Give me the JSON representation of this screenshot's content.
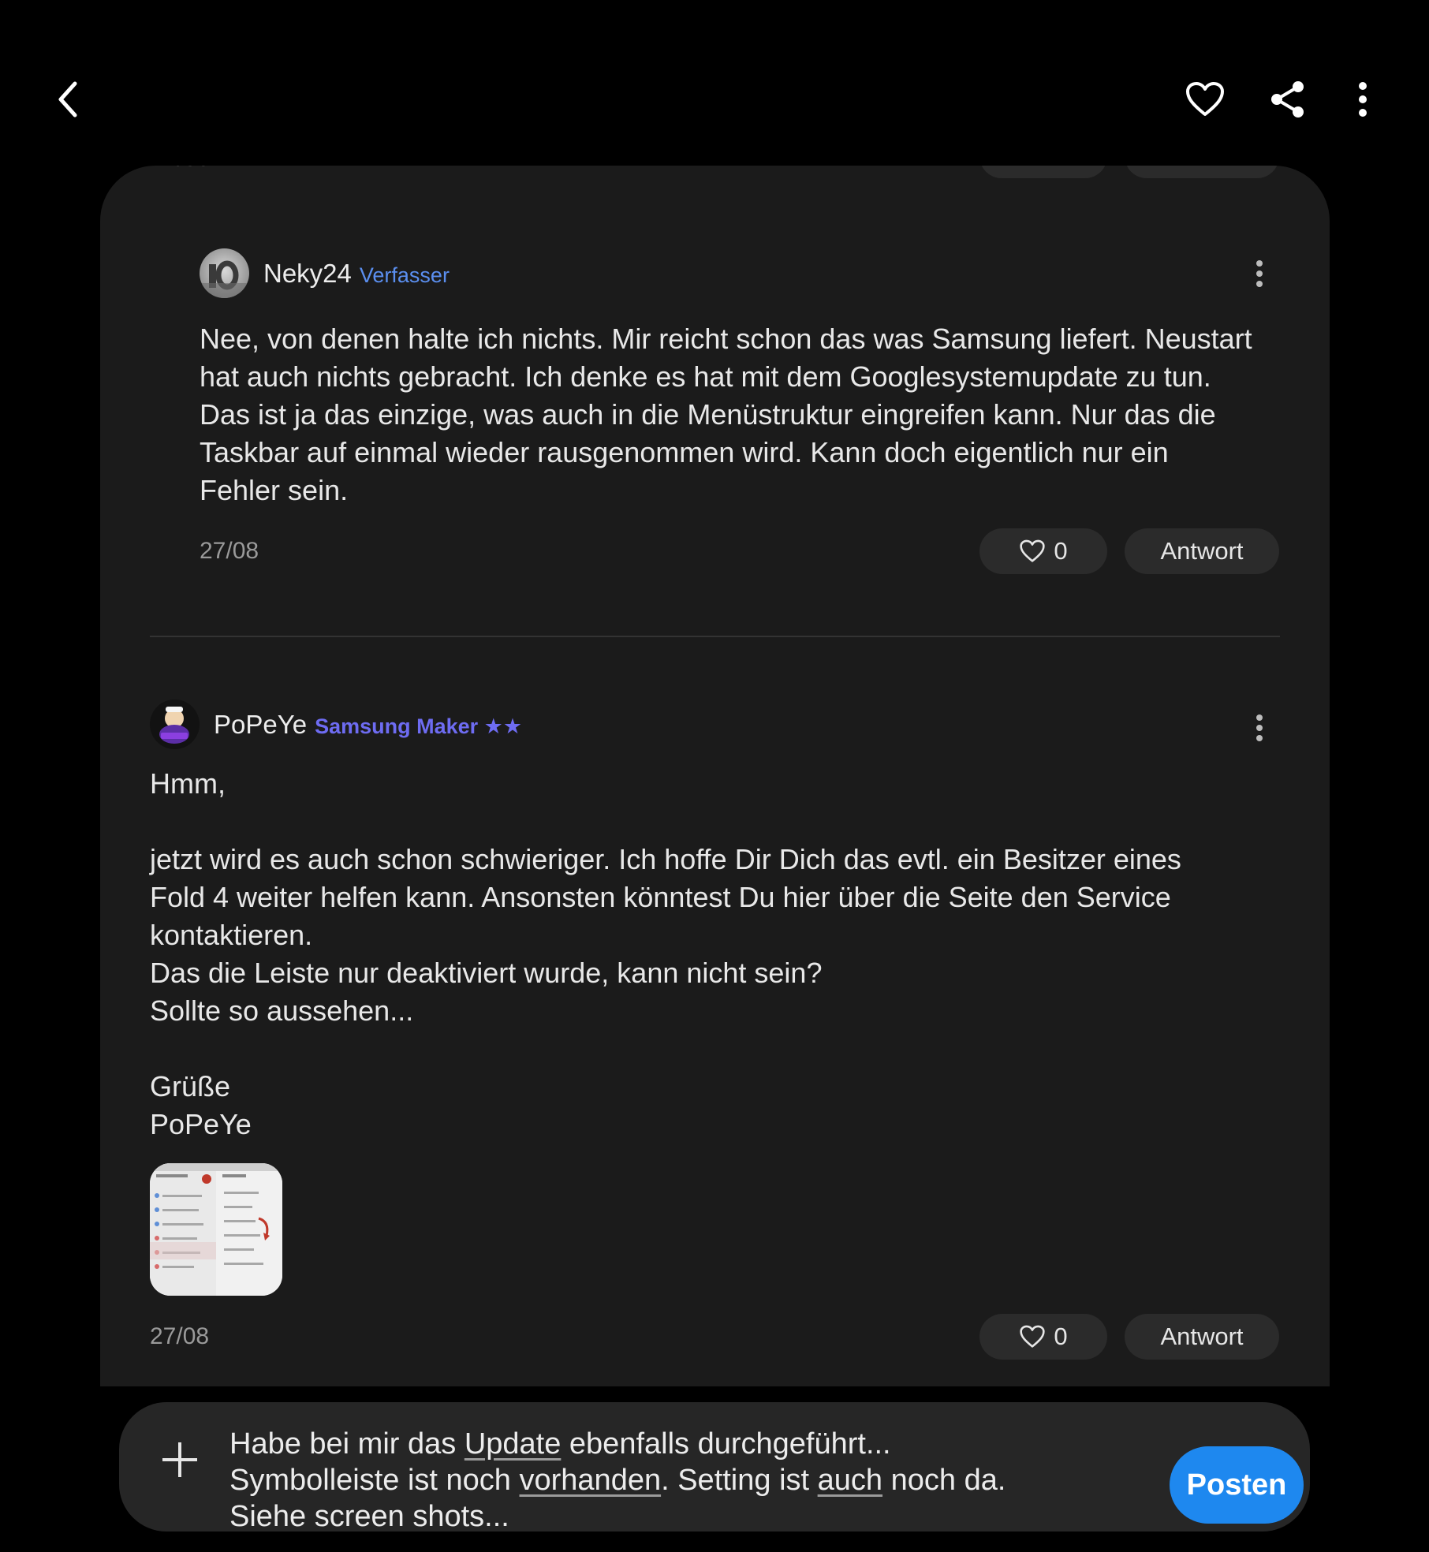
{
  "header": {
    "back_icon": "chevron-left-icon",
    "favorite_icon": "heart-outline-icon",
    "share_icon": "share-icon",
    "more_icon": "more-vertical-icon"
  },
  "previous_post_fragment": {
    "date": "27/08",
    "reply_label": "Antwort"
  },
  "posts": [
    {
      "author": "Neky24",
      "role": "Verfasser",
      "role_color": "#5b8ff0",
      "body": "Nee, von denen halte ich nichts. Mir reicht schon das was Samsung liefert. Neustart\nhat auch nichts gebracht. Ich denke es hat mit dem Googlesystemupdate zu tun.\nDas ist ja das einzige, was auch in die Menüstruktur eingreifen kann. Nur das die\nTaskbar auf einmal wieder rausgenommen wird. Kann doch eigentlich nur ein\nFehler sein.",
      "date": "27/08",
      "likes": "0",
      "reply_label": "Antwort"
    },
    {
      "author": "PoPeYe",
      "role": "Samsung Maker ★★",
      "role_color": "#6e6cf2",
      "body": "Hmm,\n\njetzt wird es auch schon schwieriger. Ich hoffe Dir Dich das evtl. ein Besitzer eines\nFold 4 weiter helfen kann. Ansonsten könntest Du hier über die Seite den Service\nkontaktieren.\nDas die Leiste nur deaktiviert wurde, kann nicht sein?\nSollte so aussehen...\n\nGrüße\nPoPeYe",
      "date": "27/08",
      "likes": "0",
      "reply_label": "Antwort"
    }
  ],
  "composer": {
    "text_segments": [
      {
        "text": "Habe bei mir das ",
        "underline": false
      },
      {
        "text": "Update",
        "underline": true
      },
      {
        "text": " ebenfalls durchgeführt... Symbolleiste ist noch ",
        "underline": false
      },
      {
        "text": "vorhanden",
        "underline": true
      },
      {
        "text": ". Setting ist ",
        "underline": false
      },
      {
        "text": "auch",
        "underline": true
      },
      {
        "text": " noch da.  Siehe screen shots...",
        "underline": false
      }
    ],
    "post_label": "Posten",
    "post_color": "#1e88ef"
  }
}
